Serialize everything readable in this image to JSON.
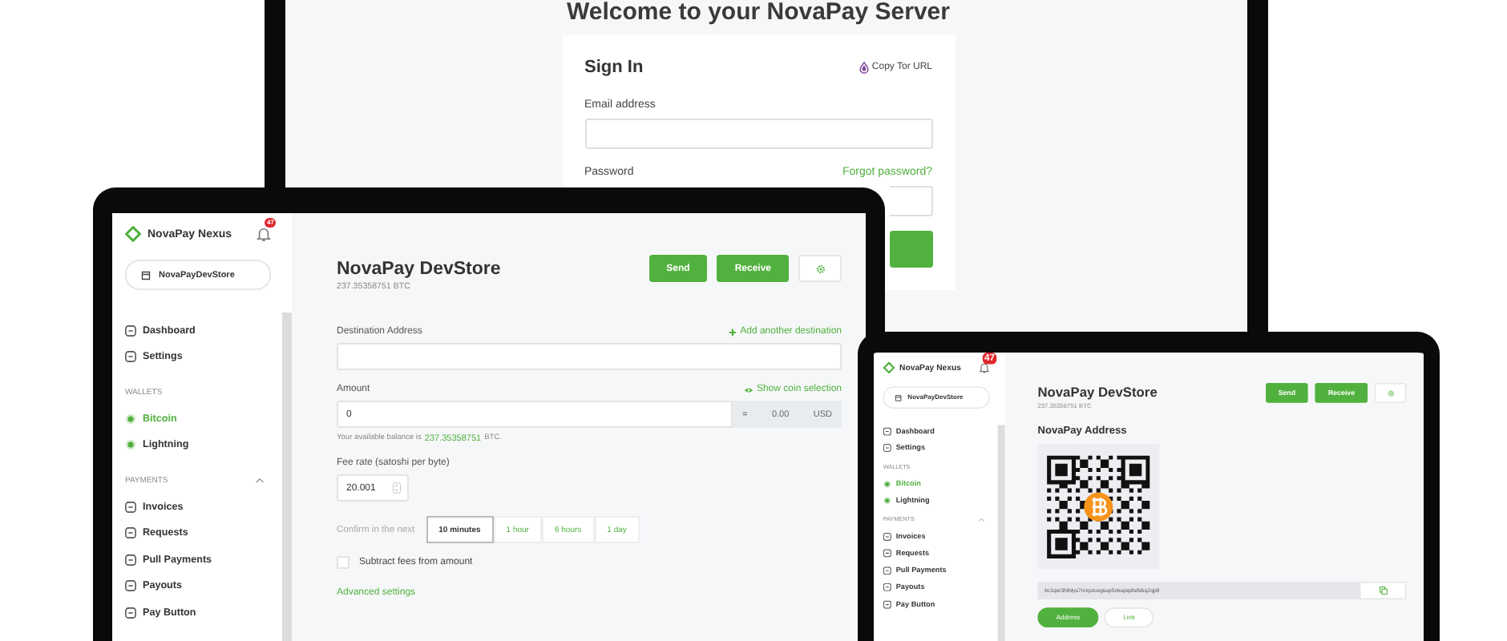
{
  "monitor": {
    "heading": "Welcome to your NovaPay Server",
    "signin": {
      "title": "Sign In",
      "tor_link": "Copy Tor URL",
      "fields": [
        {
          "label": "Email address"
        },
        {
          "label": "Password",
          "link": "Forgot password?"
        }
      ]
    }
  },
  "devices": [
    {
      "kind": "send",
      "sidebar": {
        "brand": "NovaPay Nexus",
        "notifications": "47",
        "store": "NovaPayDevStore",
        "items": [
          {
            "label": "Dashboard",
            "selected": false
          },
          {
            "label": "Settings",
            "selected": false
          }
        ],
        "sections": [
          {
            "title": "WALLETS",
            "kind": "wallets",
            "items": [
              {
                "label": "Bitcoin",
                "selected": true
              },
              {
                "label": "Lightning",
                "selected": false
              }
            ]
          },
          {
            "title": "PAYMENTS",
            "kind": "menu",
            "expanded": true,
            "items": [
              {
                "label": "Invoices",
                "selected": false
              },
              {
                "label": "Requests",
                "selected": false
              },
              {
                "label": "Pull Payments",
                "selected": false
              },
              {
                "label": "Payouts",
                "selected": false
              },
              {
                "label": "Pay Button",
                "selected": false
              }
            ]
          }
        ]
      },
      "header": {
        "title": "NovaPay DevStore",
        "balance": "237.35358751 BTC",
        "buttons": [
          "Send",
          "Receive"
        ]
      },
      "form": {
        "destination": {
          "label": "Destination Address",
          "action": "Add another destination"
        },
        "amount": {
          "label": "Amount",
          "action": "Show coin selection",
          "value": "0",
          "equals": "=",
          "fiat_value": "0.00",
          "currency": "USD",
          "help_prefix": "Your available balance is",
          "help_amount": "237.35358751",
          "help_suffix": "BTC."
        },
        "fee": {
          "label": "Fee rate (satoshi per byte)",
          "value": "20.001"
        },
        "confirm": {
          "label": "Confirm in the next",
          "options": [
            {
              "label": "10 minutes",
              "selected": true
            },
            {
              "label": "1 hour",
              "selected": false
            },
            {
              "label": "6 hours",
              "selected": false
            },
            {
              "label": "1 day",
              "selected": false
            }
          ]
        },
        "subtract": {
          "label": "Subtract fees from amount",
          "checked": false
        },
        "advanced": "Advanced settings"
      }
    },
    {
      "kind": "receive",
      "sidebar": {
        "brand": "NovaPay Nexus",
        "notifications": "47",
        "store": "NovaPayDevStore",
        "items": [
          {
            "label": "Dashboard",
            "selected": false
          },
          {
            "label": "Settings",
            "selected": false
          }
        ],
        "sections": [
          {
            "title": "WALLETS",
            "kind": "wallets",
            "items": [
              {
                "label": "Bitcoin",
                "selected": true
              },
              {
                "label": "Lightning",
                "selected": false
              }
            ]
          },
          {
            "title": "PAYMENTS",
            "kind": "menu",
            "expanded": true,
            "items": [
              {
                "label": "Invoices",
                "selected": false
              },
              {
                "label": "Requests",
                "selected": false
              },
              {
                "label": "Pull Payments",
                "selected": false
              },
              {
                "label": "Payouts",
                "selected": false
              },
              {
                "label": "Pay Button",
                "selected": false
              }
            ]
          }
        ]
      },
      "header": {
        "title": "NovaPay DevStore",
        "balance": "237.35358751 BTC",
        "buttons": [
          "Send",
          "Receive"
        ]
      },
      "receive": {
        "title": "NovaPay Address",
        "address": "bc1qsr3h8dys7rezpzusgsup5nkupspfs8zkq2qp9",
        "tabs": [
          {
            "label": "Address",
            "selected": true
          },
          {
            "label": "Link",
            "selected": false
          }
        ]
      }
    }
  ]
}
